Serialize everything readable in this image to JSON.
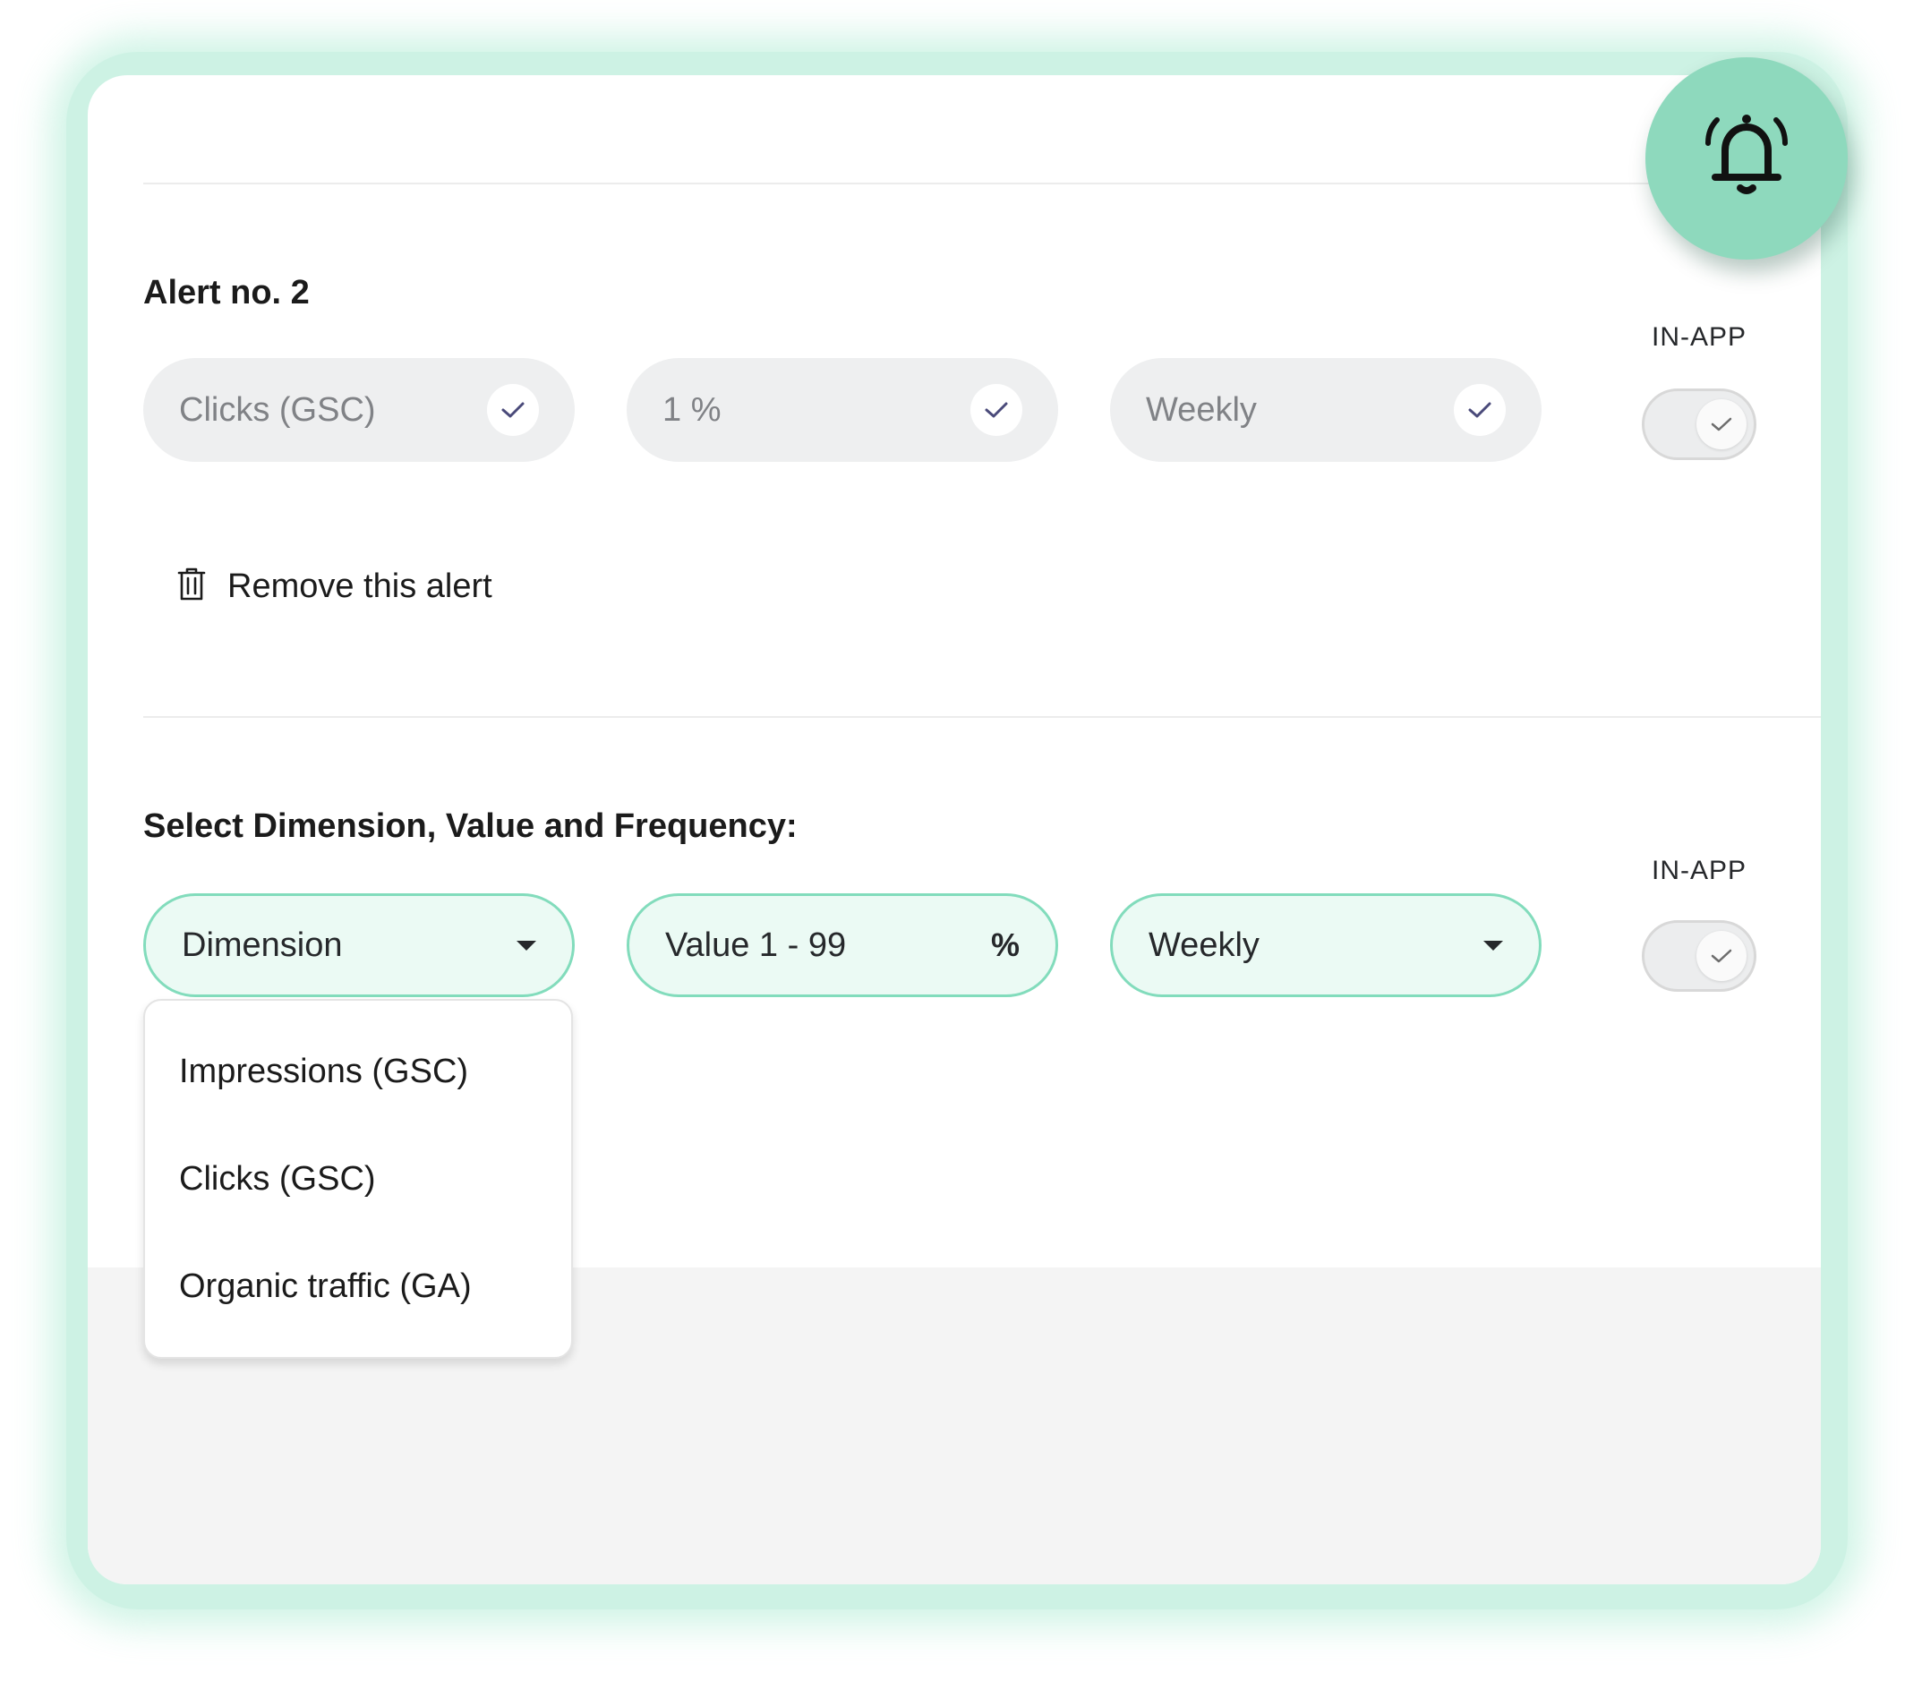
{
  "colors": {
    "accent": "#82dcbc",
    "accent_light": "#ebfaf4",
    "bell_button": "#8ed9bd",
    "check_mark": "#4a4a7a"
  },
  "alert": {
    "title": "Alert no. 2",
    "dimension": "Clicks (GSC)",
    "value": "1 %",
    "frequency": "Weekly",
    "toggle_label": "IN-APP",
    "remove_label": "Remove this alert",
    "icons": [
      "check-icon",
      "trash-icon"
    ]
  },
  "new_alert": {
    "heading": "Select Dimension, Value and Frequency:",
    "dimension_placeholder": "Dimension",
    "value_placeholder": "Value 1 - 99",
    "value_unit": "%",
    "frequency": "Weekly",
    "toggle_label": "IN-APP",
    "dimension_options": [
      "Impressions (GSC)",
      "Clicks (GSC)",
      "Organic traffic (GA)"
    ]
  },
  "bell_button": {
    "icon": "bell-ringing-icon"
  }
}
